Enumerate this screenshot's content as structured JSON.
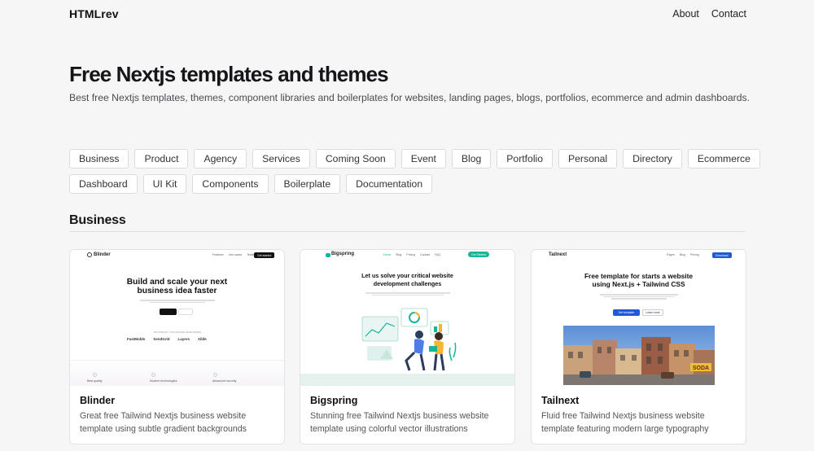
{
  "header": {
    "brand": "HTMLrev",
    "nav": [
      "About",
      "Contact"
    ]
  },
  "hero": {
    "title": "Free Nextjs templates and themes",
    "subtitle": "Best free Nextjs templates, themes, component libraries and boilerplates for websites, landing pages, blogs, portfolios, ecommerce and admin dashboards."
  },
  "tags": {
    "row1": [
      "Business",
      "Product",
      "Agency",
      "Services",
      "Coming Soon",
      "Event",
      "Blog",
      "Portfolio",
      "Personal",
      "Directory",
      "Ecommerce"
    ],
    "row2": [
      "Dashboard",
      "UI Kit",
      "Components",
      "Boilerplate",
      "Documentation"
    ]
  },
  "section": {
    "title": "Business"
  },
  "cards": [
    {
      "title": "Blinder",
      "description": "Great free Tailwind Nextjs business website template using subtle gradient backgrounds",
      "preview": {
        "logo": "Blinder",
        "links": [
          "Features",
          "Use cases",
          "Testimonials"
        ],
        "nav_button": "Get started",
        "headline_1": "Build and scale your next",
        "headline_2": "business idea faster",
        "trust_text": "TRUSTED BY THOUSANDS WORLDWIDE",
        "logos": [
          "FastMoble",
          "SendGrid",
          "Layers",
          "Xilde"
        ],
        "features": [
          "Best quality",
          "Modern technologies",
          "Advanced security"
        ]
      }
    },
    {
      "title": "Bigspring",
      "description": "Stunning free Tailwind Nextjs business website template using colorful vector illustrations",
      "preview": {
        "logo": "Bigspring",
        "links": [
          "Home",
          "Blog",
          "Pricing",
          "Contact",
          "FAQ"
        ],
        "nav_button": "Get Started",
        "headline_1": "Let us solve your critical website",
        "headline_2": "development challenges"
      }
    },
    {
      "title": "Tailnext",
      "description": "Fluid free Tailwind Nextjs business website template featuring modern large typography",
      "preview": {
        "logo": "Tailnext",
        "links": [
          "Pages",
          "Blog",
          "Pricing"
        ],
        "nav_button": "Download",
        "headline_1": "Free template for starts a website",
        "headline_2": "using Next.js + Tailwind CSS",
        "button_1": "Get template",
        "button_2": "Learn more",
        "sign": "SODA"
      }
    }
  ],
  "colors": {
    "page_bg": "#f6f6f7",
    "accent_blue": "#2059d8",
    "accent_teal": "#17b59a"
  }
}
